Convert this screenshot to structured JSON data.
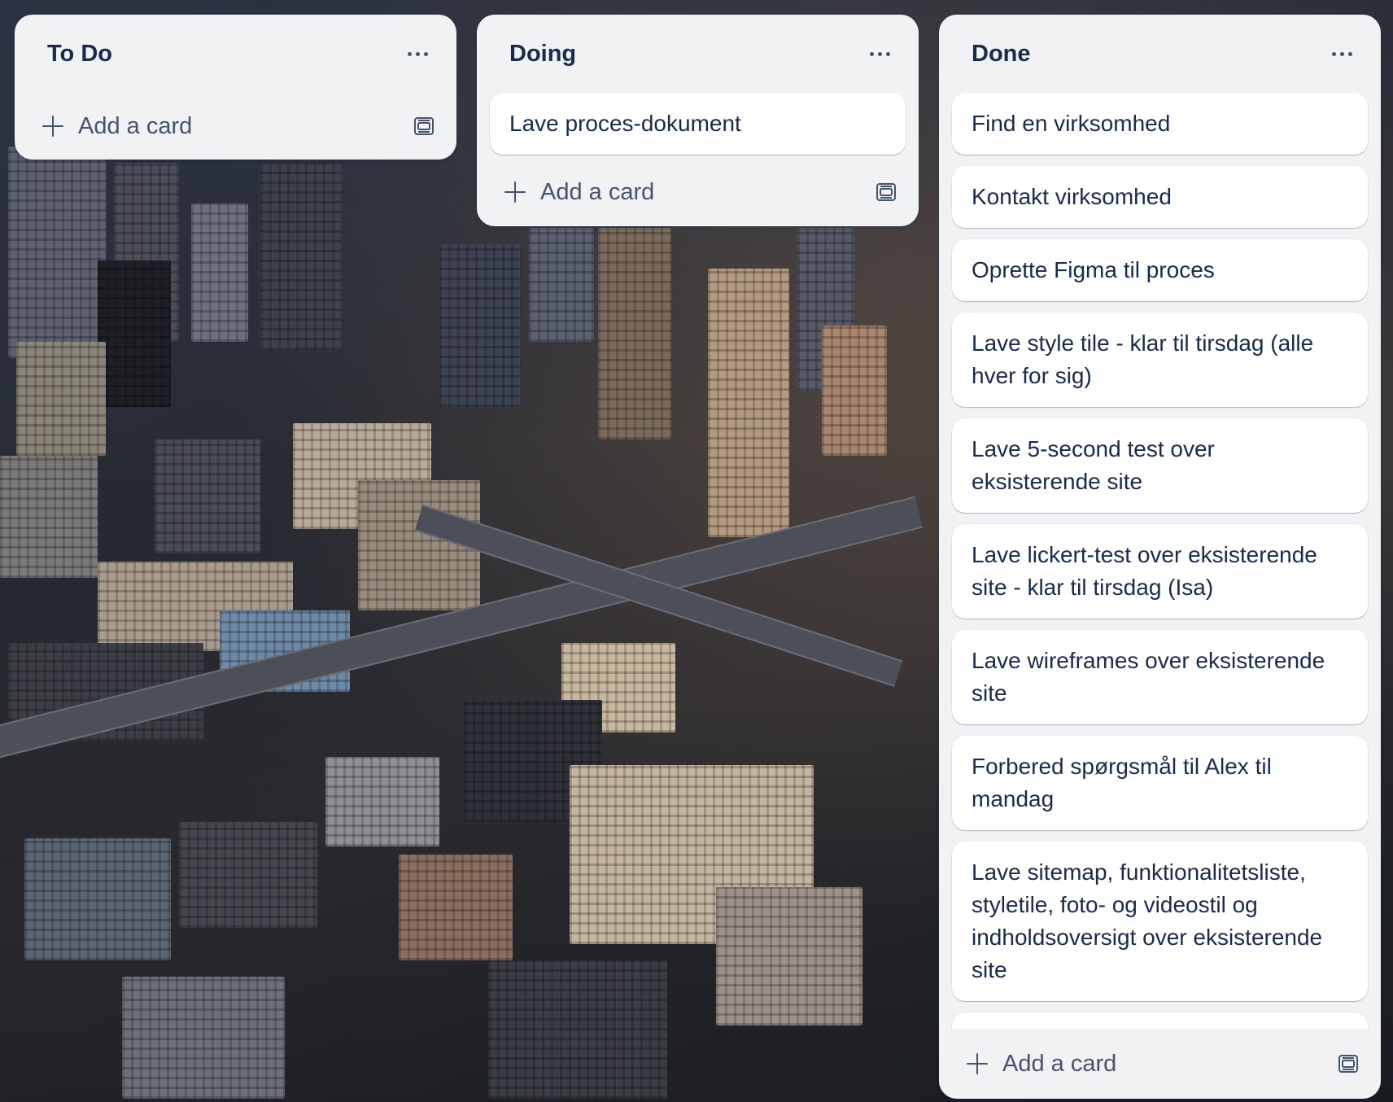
{
  "board": {
    "lists": [
      {
        "title": "To Do",
        "cards": [],
        "add_label": "Add a card"
      },
      {
        "title": "Doing",
        "cards": [
          "Lave proces-dokument"
        ],
        "add_label": "Add a card"
      },
      {
        "title": "Done",
        "cards": [
          "Find en virksomhed",
          "Kontakt virksomhed",
          "Oprette Figma til proces",
          "Lave style tile - klar til tirsdag (alle hver for sig)",
          "Lave 5-second test over eksisterende site",
          "Lave lickert-test over eksisterende site - klar til tirsdag (Isa)",
          "Lave wireframes over eksisterende site",
          "Forbered spørgsmål til Alex til mandag",
          "Lave sitemap, funktionalitetsliste, styletile, foto- og videostil og indholdsoversigt over eksisterende site"
        ],
        "add_label": "Add a card"
      }
    ]
  },
  "icons": {
    "list_menu": "more-horizontal-icon",
    "add": "plus-icon",
    "template": "card-template-icon"
  },
  "colors": {
    "list_bg": "#f1f2f4",
    "card_bg": "#ffffff",
    "text": "#172b4d",
    "muted": "#44546f"
  }
}
